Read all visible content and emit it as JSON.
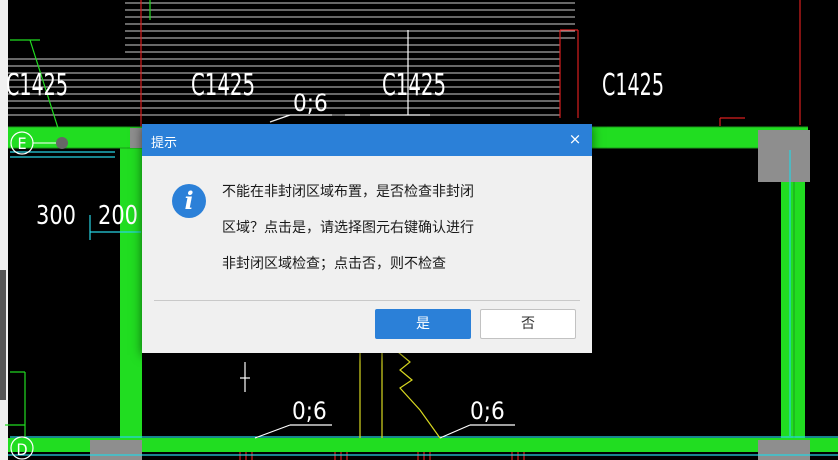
{
  "canvas": {
    "window_labels": [
      "C1425",
      "C1425",
      "C1425",
      "C1425"
    ],
    "axis_labels": [
      "E",
      "D"
    ],
    "dimension_labels": [
      "300",
      "200"
    ],
    "opening_labels": [
      "0;6",
      "0;6",
      "0;6"
    ],
    "colors": {
      "background": "#000000",
      "wall_fill": "#21dd21",
      "column": "#8e8e8e",
      "line": "#ffffff",
      "red_line": "#d81f1f",
      "cyan_line": "#27d4e2",
      "yellow_line": "#d8d820"
    }
  },
  "dialog": {
    "title": "提示",
    "close_glyph": "×",
    "icon": "info-icon",
    "message_lines": [
      "不能在非封闭区域布置，是否检查非封闭",
      "区域？点击是，请选择图元右键确认进行",
      "非封闭区域检查；点击否，则不检查"
    ],
    "yes_label": "是",
    "no_label": "否",
    "accent_color": "#2b80d8"
  }
}
